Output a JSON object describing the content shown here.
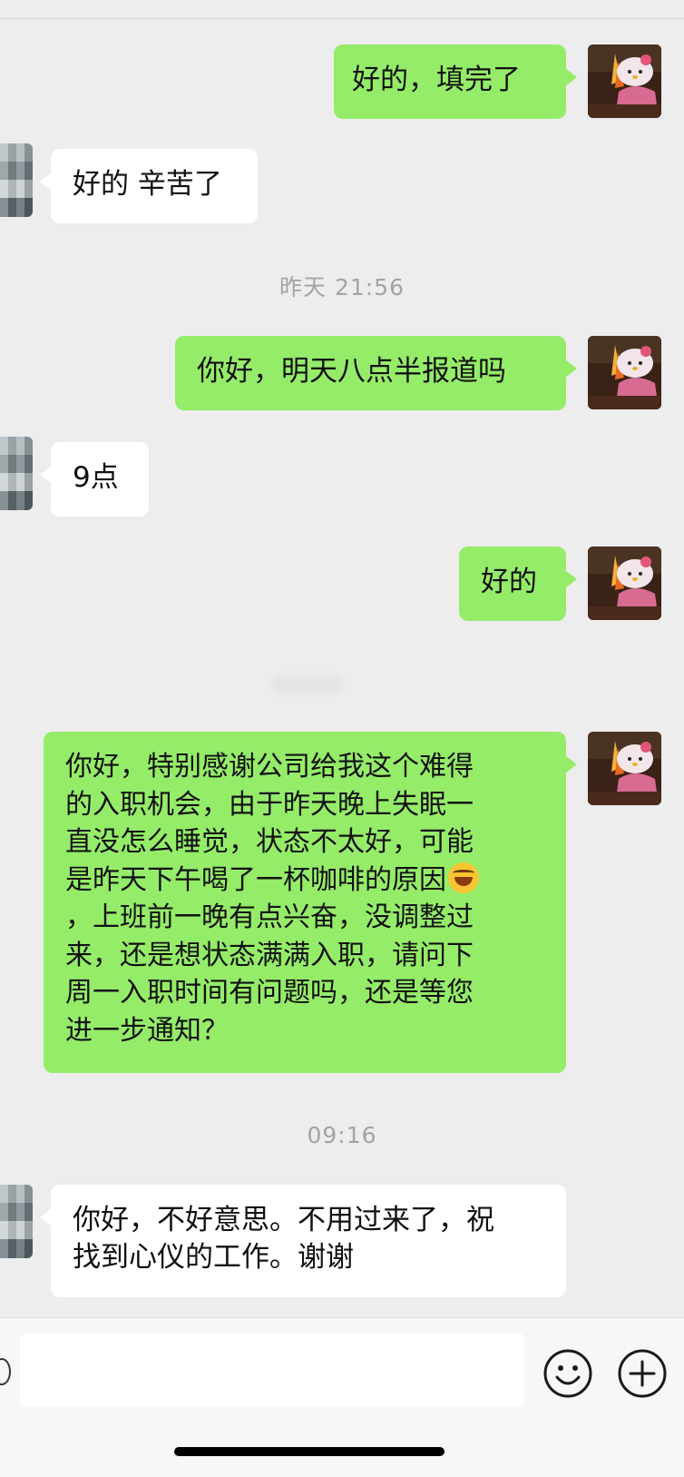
{
  "messages": [
    {
      "kind": "out",
      "text": "好的，填完了"
    },
    {
      "kind": "in",
      "text": "好的 辛苦了"
    },
    {
      "kind": "time",
      "text": "昨天 21:56"
    },
    {
      "kind": "out",
      "text": "你好，明天八点半报道吗"
    },
    {
      "kind": "in",
      "text": "9点"
    },
    {
      "kind": "out",
      "text": "好的"
    },
    {
      "kind": "out",
      "lines": [
        "你好，特别感谢公司给我这个难得",
        "的入职机会，由于昨天晚上失眠一",
        "直没怎么睡觉，状态不太好，可能",
        "是昨天下午喝了一杯咖啡的原因",
        "，上班前一晚有点兴奋，没调整过",
        "来，还是想状态满满入职，请问下",
        "周一入职时间有问题吗，还是等您",
        "进一步通知？"
      ],
      "emoji": "laughing-tears-emoji"
    },
    {
      "kind": "time",
      "text": "09:16"
    },
    {
      "kind": "in",
      "lines": [
        "你好，不好意思。不用过来了，祝",
        "找到心仪的工作。谢谢"
      ]
    }
  ],
  "input_bar": {
    "input_value": "",
    "icons": [
      "emoji-icon",
      "add-icon"
    ]
  },
  "colors": {
    "background": "#ededed",
    "outgoing_bubble": "#95ec69",
    "incoming_bubble": "#ffffff",
    "timestamp": "#a3a3a3"
  }
}
